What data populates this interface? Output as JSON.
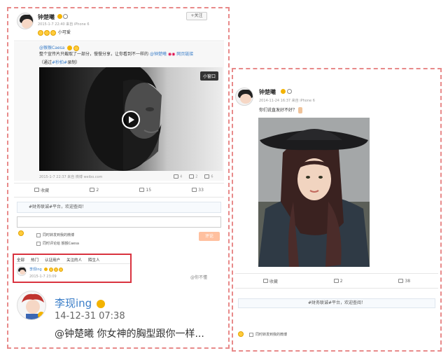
{
  "left_post": {
    "author": "钟楚曦",
    "follow_label": "+关注",
    "time": "2015-1-7 22:40 来自 iPhone 6",
    "text": "小可爱",
    "repost": {
      "handle": "@猴猴Caesa",
      "text": "整个宣传片只截取了一部分，慢慢分享，让你看到不一样的",
      "mention": "@钟楚曦",
      "link_text": "网页链接",
      "source_prefix": "（通过",
      "source_tag": "#秒拍#",
      "source_suffix": "录制）",
      "mini_window": "小窗口",
      "time": "2015-1-7 22:37 来自 微博 weibo.com",
      "stats": {
        "repost": "4",
        "comment": "2",
        "like": "6"
      }
    },
    "actions": {
      "collect": "收藏",
      "repost": "2",
      "comment": "15",
      "like": "33"
    },
    "topic_banner": "#财务联诚#平台，欢迎查阅！",
    "checkbox_repost": "同时转发到我的微博",
    "checkbox_comment": "同时评论给 猴猴Caesa",
    "submit": "评论",
    "tabs": [
      "全部",
      "热门",
      "认证用户",
      "关注的人",
      "陌生人"
    ],
    "comment": {
      "name": "李现ing",
      "time": "2015-1-7 23:09"
    },
    "watermark": "@你不懂"
  },
  "zoom_comment": {
    "name": "李现ing",
    "time": "14-12-31 07:38",
    "text": "@钟楚曦 你女神的胸型跟你一样..."
  },
  "right_post": {
    "author": "钟楚曦",
    "time": "2014-11-24 16:37 来自 iPhone 6",
    "text": "你们说直发好不好？",
    "actions": {
      "collect": "收藏",
      "repost": "2",
      "comment": "38"
    },
    "topic_banner": "#财务联诚#平台，欢迎查阅！",
    "checkbox_repost": "同时转发到我的微博"
  },
  "colors": {
    "dash": "#e88a8a",
    "highlight": "#d9333f",
    "link": "#3b7ec8",
    "accent": "#f3b300"
  }
}
